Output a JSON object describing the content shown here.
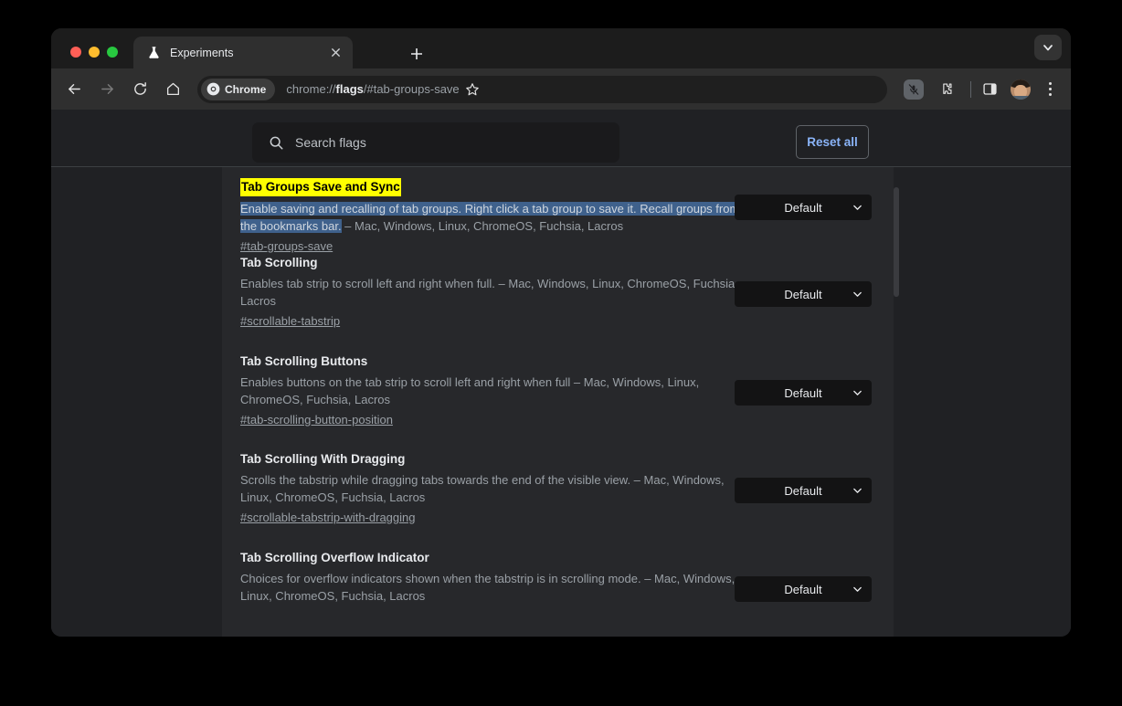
{
  "window": {
    "traffic_lights": [
      "close",
      "minimize",
      "zoom"
    ]
  },
  "tab_strip": {
    "active_tab": {
      "title": "Experiments",
      "favicon": "flask-icon",
      "close_label": "×"
    },
    "new_tab_label": "+",
    "tab_search_icon": "chevron-down-icon"
  },
  "toolbar": {
    "back_icon": "arrow-left-icon",
    "forward_icon": "arrow-right-icon",
    "reload_icon": "reload-icon",
    "home_icon": "home-icon",
    "chrome_chip_label": "Chrome",
    "url_prefix": "chrome://",
    "url_strong": "flags",
    "url_suffix": "/#tab-groups-save",
    "bookmark_icon": "star-icon",
    "mic_blocked_icon": "microphone-blocked-icon",
    "extensions_icon": "puzzle-piece-icon",
    "side_panel_icon": "side-panel-icon",
    "avatar_icon": "profile-avatar",
    "menu_icon": "three-dot-menu-icon"
  },
  "flags_page": {
    "search": {
      "icon": "search-icon",
      "placeholder": "Search flags",
      "value": ""
    },
    "reset_all_label": "Reset all",
    "flags": [
      {
        "title": "Tab Groups Save and Sync",
        "title_highlighted": true,
        "desc_selected": "Enable saving and recalling of tab groups. Right click a tab group to save it. Recall groups from the bookmarks bar.",
        "desc_rest": " – Mac, Windows, Linux, ChromeOS, Fuchsia, Lacros",
        "link": "#tab-groups-save",
        "select_value": "Default"
      },
      {
        "title": "Tab Scrolling",
        "title_highlighted": false,
        "desc_selected": "",
        "desc_rest": "Enables tab strip to scroll left and right when full. – Mac, Windows, Linux, ChromeOS, Fuchsia, Lacros",
        "link": "#scrollable-tabstrip",
        "select_value": "Default"
      },
      {
        "title": "Tab Scrolling Buttons",
        "title_highlighted": false,
        "desc_selected": "",
        "desc_rest": "Enables buttons on the tab strip to scroll left and right when full – Mac, Windows, Linux, ChromeOS, Fuchsia, Lacros",
        "link": "#tab-scrolling-button-position",
        "select_value": "Default"
      },
      {
        "title": "Tab Scrolling With Dragging",
        "title_highlighted": false,
        "desc_selected": "",
        "desc_rest": "Scrolls the tabstrip while dragging tabs towards the end of the visible view. – Mac, Windows, Linux, ChromeOS, Fuchsia, Lacros",
        "link": "#scrollable-tabstrip-with-dragging",
        "select_value": "Default"
      },
      {
        "title": "Tab Scrolling Overflow Indicator",
        "title_highlighted": false,
        "desc_selected": "",
        "desc_rest": "Choices for overflow indicators shown when the tabstrip is in scrolling mode. – Mac, Windows, Linux, ChromeOS, Fuchsia, Lacros",
        "link": "",
        "select_value": "Default"
      }
    ]
  },
  "colors": {
    "accent_blue": "#8ab4f8",
    "highlight_yellow": "#ffff00",
    "selection_blue": "#3f618c",
    "page_bg": "#202124",
    "panel_bg": "#27282b"
  }
}
